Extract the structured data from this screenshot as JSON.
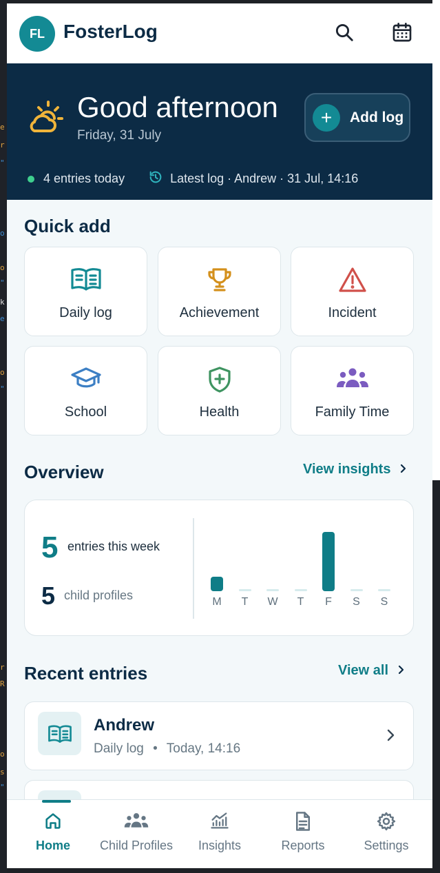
{
  "app": {
    "avatar_initials": "FL",
    "title": "FosterLog"
  },
  "topbar": {
    "search_icon": "search-icon",
    "calendar_icon": "calendar-icon"
  },
  "hero": {
    "greeting": "Good afternoon",
    "date": "Friday, 31 July",
    "add_log_label": "Add log",
    "entries_today": "4 entries today",
    "latest_log": "Latest log · Andrew · 31 Jul, 14:16"
  },
  "quick_add": {
    "title": "Quick add",
    "items": [
      {
        "label": "Daily log",
        "icon": "book-icon",
        "color": "#138a94"
      },
      {
        "label": "Achievement",
        "icon": "trophy-icon",
        "color": "#d4901c"
      },
      {
        "label": "Incident",
        "icon": "warning-icon",
        "color": "#d0504a"
      },
      {
        "label": "School",
        "icon": "graduation-cap-icon",
        "color": "#3c7fc4"
      },
      {
        "label": "Health",
        "icon": "shield-plus-icon",
        "color": "#3f9461"
      },
      {
        "label": "Family Time",
        "icon": "people-icon",
        "color": "#7b5cc0"
      }
    ]
  },
  "overview": {
    "title": "Overview",
    "link": "View insights",
    "entries_week_value": "5",
    "entries_week_label": "entries this week",
    "child_profiles_value": "5",
    "child_profiles_label": "child profiles"
  },
  "chart_data": {
    "type": "bar",
    "categories": [
      "M",
      "T",
      "W",
      "T",
      "F",
      "S",
      "S"
    ],
    "values": [
      1,
      0,
      0,
      0,
      4,
      0,
      0
    ]
  },
  "recent": {
    "title": "Recent entries",
    "link": "View all",
    "entries": [
      {
        "name": "Andrew",
        "type": "Daily log",
        "separator": "•",
        "time": "Today, 14:16",
        "icon": "book-icon"
      }
    ]
  },
  "nav": {
    "items": [
      {
        "label": "Home",
        "icon": "home-icon",
        "active": true
      },
      {
        "label": "Child Profiles",
        "icon": "people-icon"
      },
      {
        "label": "Insights",
        "icon": "chart-icon"
      },
      {
        "label": "Reports",
        "icon": "document-icon"
      },
      {
        "label": "Settings",
        "icon": "gear-icon"
      }
    ]
  }
}
